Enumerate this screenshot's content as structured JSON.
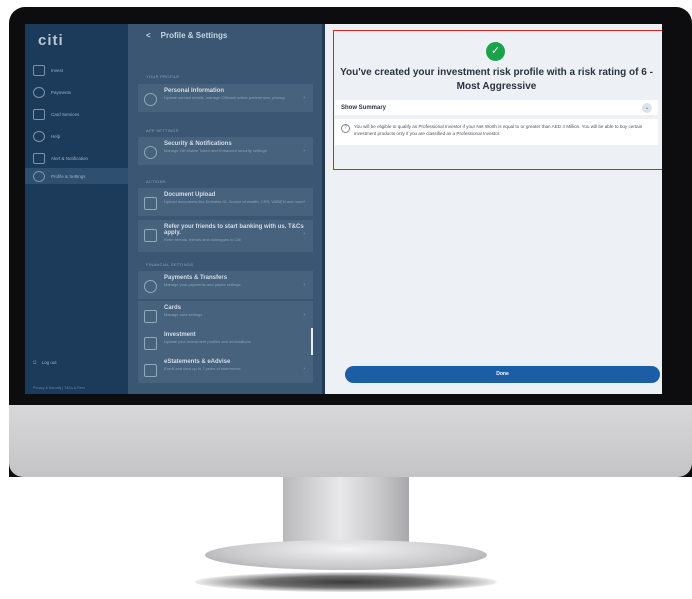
{
  "sidebar": {
    "logo": "citi",
    "items": [
      {
        "label": "Invest",
        "active": false
      },
      {
        "label": "Payments",
        "active": false
      },
      {
        "label": "Card Services",
        "active": false
      },
      {
        "label": "Help",
        "active": false
      },
      {
        "label": "Alert & Notification",
        "active": false
      },
      {
        "label": "Profile & Settings",
        "active": true
      }
    ],
    "logout": "Log out",
    "footer": "Privacy & Security  |  T&Cs & Fees"
  },
  "settings": {
    "back": "<",
    "title": "Profile & Settings",
    "sections": {
      "profile": "YOUR PROFILE",
      "app": "APP SETTINGS",
      "actions": "ACTIONS",
      "financial": "FINANCIAL SETTINGS"
    },
    "rows": [
      {
        "title": "Personal Information",
        "subtitle": "Update contact details, manage Citibank online preferences, privacy"
      },
      {
        "title": "Security & Notifications",
        "subtitle": "Manage Citi Mobile Token and Enhanced security settings"
      },
      {
        "title": "Document Upload",
        "subtitle": "Upload documents like Emirates ID, Source of wealth, CRS, W8BEN and more"
      },
      {
        "title": "Refer your friends to start banking with us. T&Cs apply.",
        "subtitle": "Refer friends, friends and colleagues to Citi"
      },
      {
        "title": "Payments & Transfers",
        "subtitle": "Manage your payments and payee settings"
      },
      {
        "title": "Cards",
        "subtitle": "Manage card settings"
      },
      {
        "title": "Investment",
        "subtitle": "Update your investment profiles and declarations"
      },
      {
        "title": "eStatements & eAdvise",
        "subtitle": "Enroll and view up to 7 years of statements"
      }
    ]
  },
  "panel": {
    "headline": "You've created your investment risk profile with a risk rating of 6 - Most Aggressive",
    "summary_label": "Show Summary",
    "note": "You will be eligible to qualify as Professional Investor if your Net Worth is equal to or greater than AED 4 Million. You will be able to buy certain investment products only if you are classified as a Professional Investor.",
    "done_label": "Done"
  }
}
